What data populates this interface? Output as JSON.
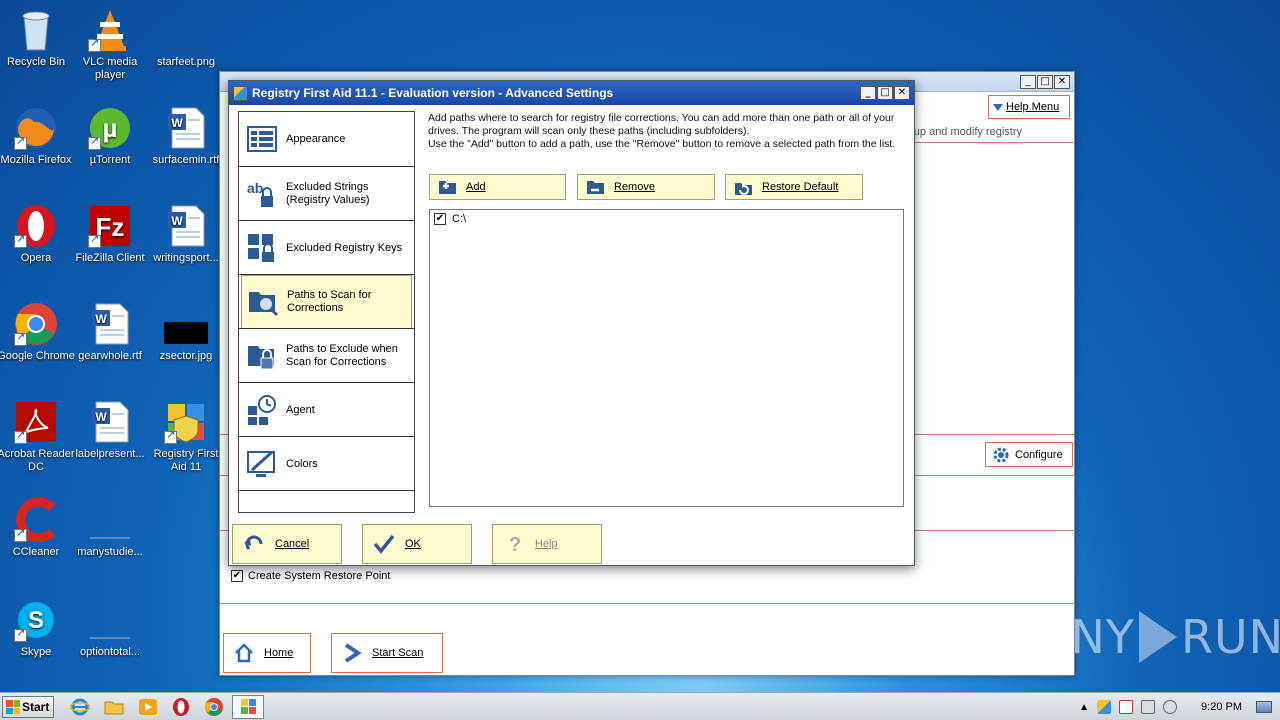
{
  "desktop": {
    "icons": [
      {
        "label": "Recycle Bin",
        "icon": "recycle-bin-icon"
      },
      {
        "label": "VLC media player",
        "icon": "vlc-icon"
      },
      {
        "label": "starfeet.png",
        "icon": "image-file-icon"
      },
      {
        "label": "Mozilla Firefox",
        "icon": "firefox-icon"
      },
      {
        "label": "µTorrent",
        "icon": "utorrent-icon"
      },
      {
        "label": "surfacemin.rtf",
        "icon": "word-doc-icon"
      },
      {
        "label": "Opera",
        "icon": "opera-icon"
      },
      {
        "label": "FileZilla Client",
        "icon": "filezilla-icon"
      },
      {
        "label": "writingsport...",
        "icon": "word-doc-icon"
      },
      {
        "label": "Google Chrome",
        "icon": "chrome-icon"
      },
      {
        "label": "gearwhole.rtf",
        "icon": "word-doc-icon"
      },
      {
        "label": "zsector.jpg",
        "icon": "image-file-icon"
      },
      {
        "label": "Acrobat Reader DC",
        "icon": "acrobat-icon"
      },
      {
        "label": "labelpresent...",
        "icon": "word-doc-icon"
      },
      {
        "label": "Registry First Aid 11",
        "icon": "registry-first-aid-icon"
      },
      {
        "label": "CCleaner",
        "icon": "ccleaner-icon"
      },
      {
        "label": "manystudie...",
        "icon": "blank-file-icon"
      },
      {
        "label": "Skype",
        "icon": "skype-icon"
      },
      {
        "label": "optiontotal...",
        "icon": "blank-file-icon"
      }
    ]
  },
  "main_window": {
    "help_menu_label": "Help Menu",
    "hint_text": "up and modify registry",
    "configure_label": "Configure",
    "restore_point_label": "Create System Restore Point",
    "restore_point_checked": true,
    "home_label": "Home",
    "start_scan_label": "Start Scan"
  },
  "dialog": {
    "title": "Registry First Aid 11.1 - Evaluation version - Advanced Settings",
    "nav": [
      {
        "label": "Appearance",
        "icon": "appearance-icon"
      },
      {
        "label": "Excluded Strings (Registry Values)",
        "icon": "excluded-strings-icon"
      },
      {
        "label": "Excluded Registry Keys",
        "icon": "excluded-keys-icon"
      },
      {
        "label": "Paths to Scan for Corrections",
        "icon": "scan-paths-icon",
        "selected": true
      },
      {
        "label": "Paths to Exclude when Scan for Corrections",
        "icon": "exclude-paths-icon"
      },
      {
        "label": "Agent",
        "icon": "agent-icon"
      },
      {
        "label": "Colors",
        "icon": "colors-icon"
      }
    ],
    "description": "Add paths where to search for registry file corrections. You can add more than one path or all of your drives. The program will scan only these paths (including subfolders).\nUse the \"Add\" button to add a path, use the \"Remove\" button to remove a selected path from the list.",
    "add_label": "Add",
    "remove_label": "Remove",
    "restore_default_label": "Restore Default",
    "paths": [
      {
        "path": "C:\\",
        "checked": true
      }
    ],
    "cancel_label": "Cancel",
    "ok_label": "OK",
    "help_label": "Help"
  },
  "watermark": {
    "text_left": "ANY",
    "text_right": "RUN"
  },
  "taskbar": {
    "start_label": "Start",
    "pinned": [
      "ie-icon",
      "explorer-icon",
      "media-player-icon",
      "opera-icon",
      "chrome-icon",
      "registry-first-aid-icon"
    ],
    "clock": "9:20 PM"
  },
  "colors": {
    "accent_orange": "#d47256",
    "selected_bg": "#fffbd0",
    "title_blue": "#1948a0"
  }
}
